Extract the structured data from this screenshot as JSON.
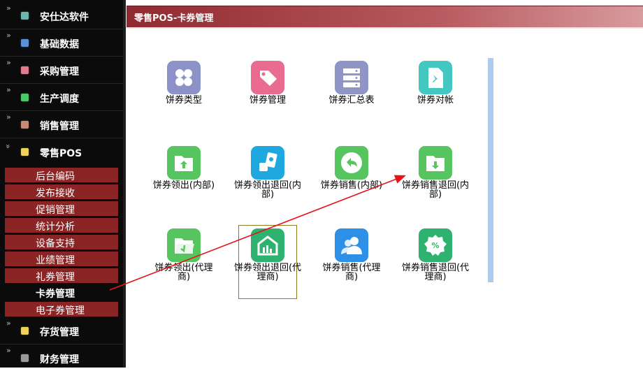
{
  "sidebar": {
    "categories": [
      {
        "label": "安仕达软件",
        "icon": "software-icon",
        "color": "#6ab7b0"
      },
      {
        "label": "基础数据",
        "icon": "database-icon",
        "color": "#5b8fd6"
      },
      {
        "label": "采购管理",
        "icon": "cart-icon",
        "color": "#e67a8c"
      },
      {
        "label": "生产调度",
        "icon": "factory-icon",
        "color": "#4cc86a"
      },
      {
        "label": "销售管理",
        "icon": "sales-icon",
        "color": "#c98a74"
      },
      {
        "label": "零售POS",
        "icon": "pos-icon",
        "color": "#f0d25a"
      },
      {
        "label": "存货管理",
        "icon": "inventory-icon",
        "color": "#f0d25a"
      },
      {
        "label": "财务管理",
        "icon": "finance-icon",
        "color": "#9a9a9a"
      }
    ],
    "pos_items": [
      "后台编码",
      "发布接收",
      "促销管理",
      "统计分析",
      "设备支持",
      "业绩管理",
      "礼券管理",
      "卡券管理",
      "电子券管理"
    ]
  },
  "header": {
    "title": "零售POS-卡券管理"
  },
  "tiles": [
    {
      "label": "饼券类型",
      "icon": "grid-icon",
      "color": "#8c92c8"
    },
    {
      "label": "饼券管理",
      "icon": "tag-icon",
      "color": "#e96b8f"
    },
    {
      "label": "饼券汇总表",
      "icon": "server-icon",
      "color": "#8f95c5"
    },
    {
      "label": "饼券对帐",
      "icon": "pin-document-icon",
      "color": "#43c7c0"
    },
    {
      "label": "饼券领出(内部)",
      "icon": "folder-upload-icon",
      "color": "#56c45f"
    },
    {
      "label": "饼券领出退回(内部)",
      "icon": "coupons-icon",
      "color": "#1fa8df"
    },
    {
      "label": "饼券销售(内部)",
      "icon": "undo-circle-icon",
      "color": "#56c45f"
    },
    {
      "label": "饼券销售退回(内部)",
      "icon": "folder-download-icon",
      "color": "#56c45f"
    },
    {
      "label": "饼券领出(代理商)",
      "icon": "folder-open-icon",
      "color": "#56c45f"
    },
    {
      "label": "饼券领出退回(代理商)",
      "icon": "warehouse-icon",
      "color": "#2eb26f"
    },
    {
      "label": "饼券销售(代理商)",
      "icon": "users-icon",
      "color": "#2d8fe6"
    },
    {
      "label": "饼券销售退回(代理商)",
      "icon": "discount-badge-icon",
      "color": "#2eb26f"
    }
  ],
  "colors": {
    "accent": "#8b2424",
    "header": "#a0373c",
    "arrow": "#e5141a"
  }
}
